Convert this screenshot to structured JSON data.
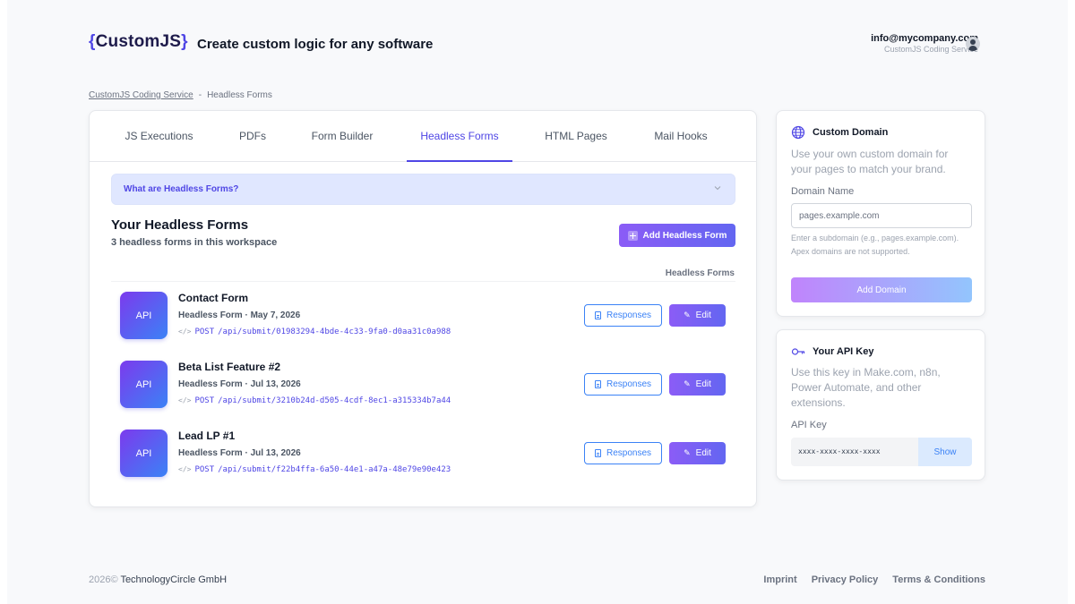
{
  "header": {
    "logo": {
      "open_brace": "{",
      "name": "CustomJS",
      "close_brace": "}"
    },
    "tagline": "Create custom logic for any software",
    "user": {
      "email": "info@mycompany.com",
      "subtitle": "CustomJS Coding Service",
      "avatar_icon": "user-avatar-icon"
    }
  },
  "breadcrumb": {
    "root": "CustomJS Coding Service",
    "separator": "-",
    "current": "Headless Forms"
  },
  "tabs": [
    {
      "label": "JS Executions",
      "active": false
    },
    {
      "label": "PDFs",
      "active": false
    },
    {
      "label": "Form Builder",
      "active": false
    },
    {
      "label": "Headless Forms",
      "active": true
    },
    {
      "label": "HTML Pages",
      "active": false
    },
    {
      "label": "Mail Hooks",
      "active": false
    }
  ],
  "accordion": {
    "label": "What are Headless Forms?",
    "icon": "chevron-down-icon"
  },
  "forms_section": {
    "title": "Your Headless Forms",
    "subtitle": "3 headless forms in this workspace",
    "add_button_label": "Add Headless Form",
    "list_label": "Headless Forms"
  },
  "forms": [
    {
      "badge": "API",
      "title": "Contact Form",
      "meta": "Headless Form · May 7, 2026",
      "method": "POST",
      "endpoint": "/api/submit/01983294-4bde-4c33-9fa0-d0aa31c0a988",
      "responses_label": "Responses",
      "edit_label": "Edit"
    },
    {
      "badge": "API",
      "title": "Beta List Feature #2",
      "meta": "Headless Form · Jul 13, 2026",
      "method": "POST",
      "endpoint": "/api/submit/3210b24d-d505-4cdf-8ec1-a315334b7a44",
      "responses_label": "Responses",
      "edit_label": "Edit"
    },
    {
      "badge": "API",
      "title": "Lead LP #1",
      "meta": "Headless Form · Jul 13, 2026",
      "method": "POST",
      "endpoint": "/api/submit/f22b4ffa-6a50-44e1-a47a-48e79e90e423",
      "responses_label": "Responses",
      "edit_label": "Edit"
    }
  ],
  "custom_domain": {
    "icon": "globe-icon",
    "title": "Custom Domain",
    "description": "Use your own custom domain for your pages to match your brand.",
    "field_label": "Domain Name",
    "placeholder": "pages.example.com",
    "hint": "Enter a subdomain (e.g., pages.example.com). Apex domains are not supported.",
    "button_label": "Add Domain"
  },
  "api_key": {
    "icon": "key-icon",
    "title": "Your API Key",
    "description": "Use this key in Make.com, n8n, Power Automate, and other extensions.",
    "field_label": "API Key",
    "masked_value": "xxxx-xxxx-xxxx-xxxx",
    "show_label": "Show"
  },
  "footer": {
    "year": "2026©",
    "company": "TechnologyCircle GmbH",
    "links": [
      "Imprint",
      "Privacy Policy",
      "Terms & Conditions"
    ]
  },
  "colors": {
    "accent": "#4f46e5",
    "button_gradient_start": "#8b5cf6",
    "button_gradient_end": "#6366f1",
    "link_blue": "#3b82f6",
    "accordion_bg": "#e0e7ff"
  }
}
